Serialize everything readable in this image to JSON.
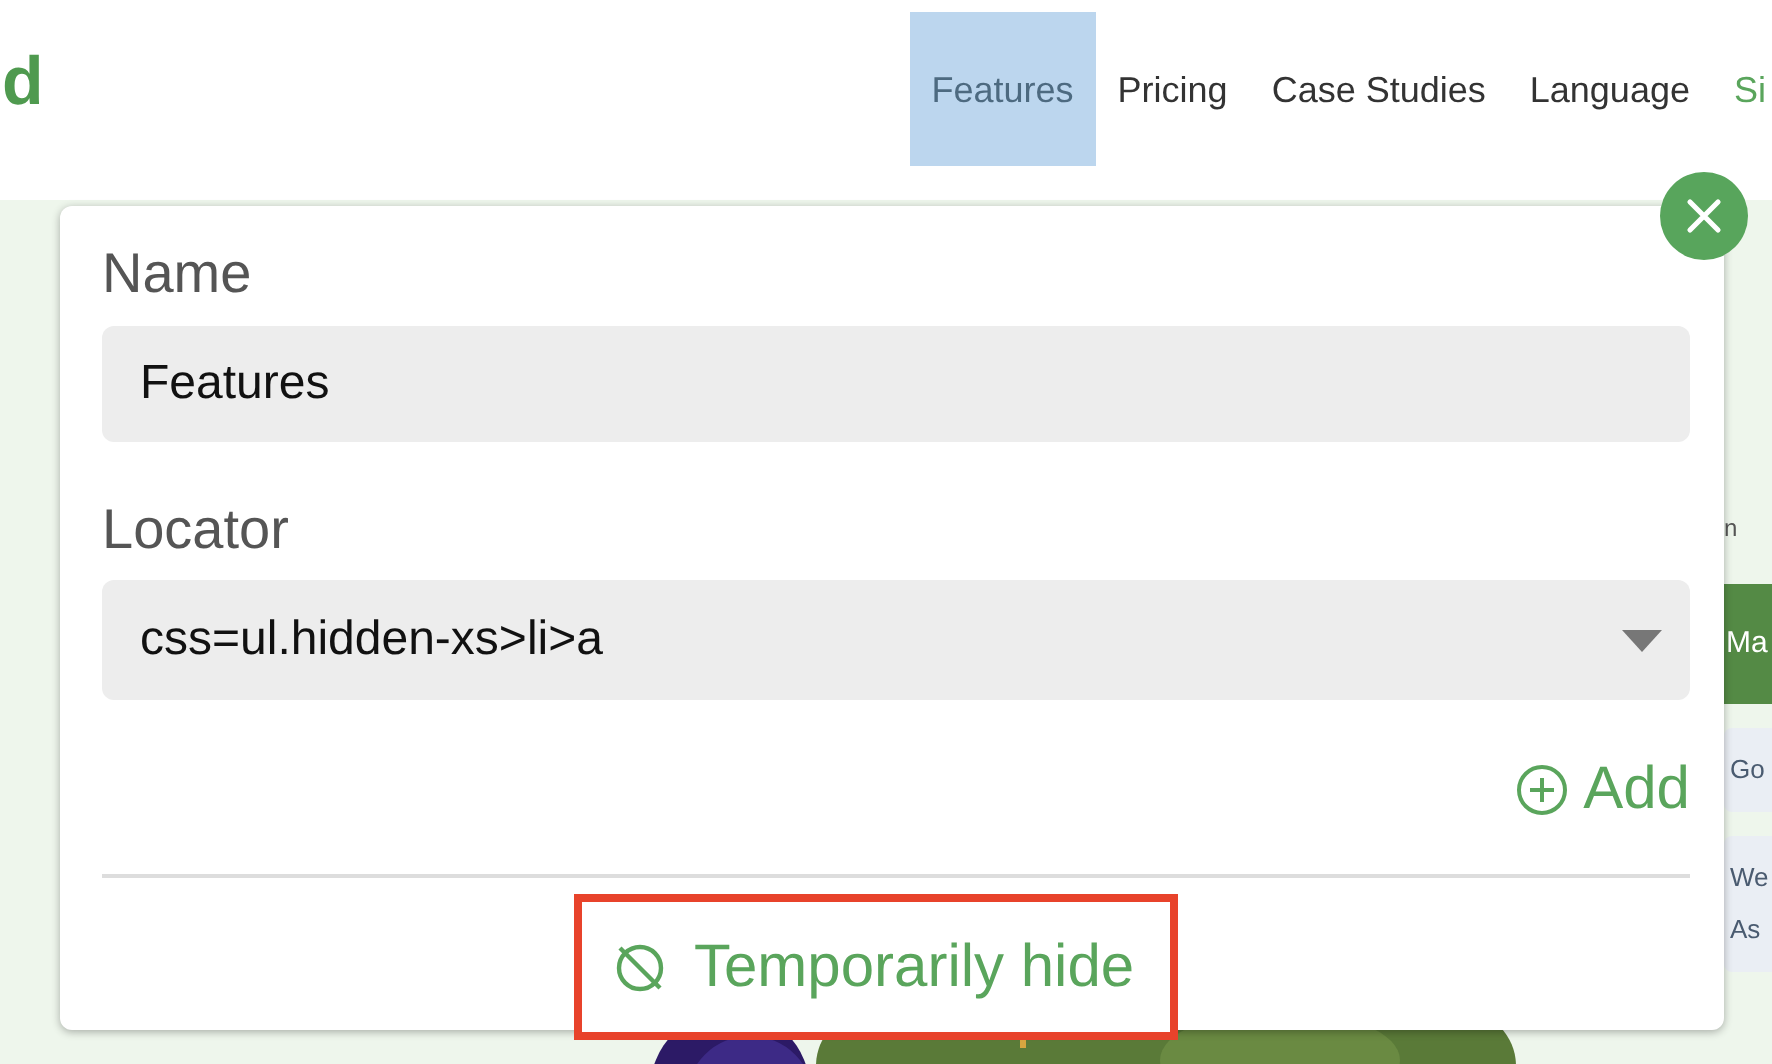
{
  "header": {
    "logo": "d",
    "nav": [
      {
        "label": "Features",
        "selected": true,
        "kind": "link"
      },
      {
        "label": "Pricing",
        "selected": false,
        "kind": "link"
      },
      {
        "label": "Case Studies",
        "selected": false,
        "kind": "link"
      },
      {
        "label": "Language",
        "selected": false,
        "kind": "link"
      },
      {
        "label": "Si",
        "selected": false,
        "kind": "accent"
      }
    ]
  },
  "background": {
    "sidebar_text": "n",
    "sidebar_button": "Ma",
    "sidebar_items": [
      {
        "lines": [
          "Go"
        ]
      },
      {
        "lines": [
          "We",
          "As"
        ]
      }
    ]
  },
  "dialog": {
    "name_label": "Name",
    "name_value": "Features",
    "locator_label": "Locator",
    "locator_value": "css=ul.hidden-xs>li>a",
    "add": "Add",
    "hide": "Temporarily hide"
  }
}
